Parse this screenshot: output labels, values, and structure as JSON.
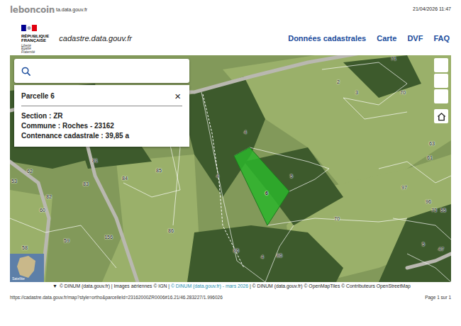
{
  "print_header": {
    "watermark": "leboncoin",
    "url": "ta.data.gouv.fr",
    "datetime": "21/04/2026 11:47"
  },
  "header": {
    "logo": [
      "RÉPUBLIQUE",
      "FRANÇAISE"
    ],
    "motto": [
      "Liberté",
      "Égalité",
      "Fraternité"
    ],
    "site": "cadastre.data.gouv.fr",
    "nav": [
      {
        "label": "Données cadastrales"
      },
      {
        "label": "Carte"
      },
      {
        "label": "DVF"
      },
      {
        "label": "FAQ"
      }
    ]
  },
  "popup": {
    "title": "Parcelle 6",
    "close": "×",
    "fields": [
      {
        "label": "Section :",
        "value": "ZR"
      },
      {
        "label": "Commune :",
        "value": "Roches - 23162"
      },
      {
        "label": "Contenance cadastrale :",
        "value": "39,85 a"
      }
    ]
  },
  "map": {
    "inset": "Satellite",
    "parcels": [
      {
        "label": "71",
        "selected": false
      },
      {
        "label": "2",
        "selected": false
      },
      {
        "label": "3",
        "selected": false
      },
      {
        "label": "70",
        "selected": false
      },
      {
        "label": "4",
        "selected": false
      },
      {
        "label": "4",
        "selected": false
      },
      {
        "label": "5",
        "selected": false
      },
      {
        "label": "6",
        "selected": true
      },
      {
        "label": "70",
        "selected": false
      },
      {
        "label": "86",
        "selected": false
      },
      {
        "label": "4",
        "selected": false
      },
      {
        "label": "86",
        "selected": false
      },
      {
        "label": "86",
        "selected": false
      },
      {
        "label": "156",
        "selected": false
      },
      {
        "label": "81",
        "selected": false
      },
      {
        "label": "84",
        "selected": false
      },
      {
        "label": "85",
        "selected": false
      },
      {
        "label": "83",
        "selected": false
      },
      {
        "label": "82",
        "selected": false
      },
      {
        "label": "62",
        "selected": false
      },
      {
        "label": "53",
        "selected": false
      },
      {
        "label": "60",
        "selected": false
      },
      {
        "label": "59",
        "selected": false
      },
      {
        "label": "58",
        "selected": false
      },
      {
        "label": "97",
        "selected": false
      },
      {
        "label": "63",
        "selected": false
      },
      {
        "label": "61",
        "selected": false
      },
      {
        "label": "96",
        "selected": false
      },
      {
        "label": "73",
        "selected": false
      },
      {
        "label": "55",
        "selected": false
      },
      {
        "label": "5",
        "selected": false
      },
      {
        "label": "47",
        "selected": false
      }
    ]
  },
  "attribution": {
    "toggle": "▼",
    "parts": [
      {
        "text": "© DINUM (data.gouv.fr) | Images aériennes © IGN | ",
        "link": false
      },
      {
        "text": "© DINUM (data.gouv.fr) - mars 2026",
        "link": true
      },
      {
        "text": " | © DINUM (data.gouv.fr) © OpenMapTiles © Contributeurs OpenStreetMap",
        "link": false
      }
    ]
  },
  "print_footer": {
    "url": "https://cadastre.data.gouv.fr/map?style=ortho&parcelleId=23162000ZR0006#16.21/46.283227/1.996026",
    "page": "Page 1 sur 1"
  }
}
